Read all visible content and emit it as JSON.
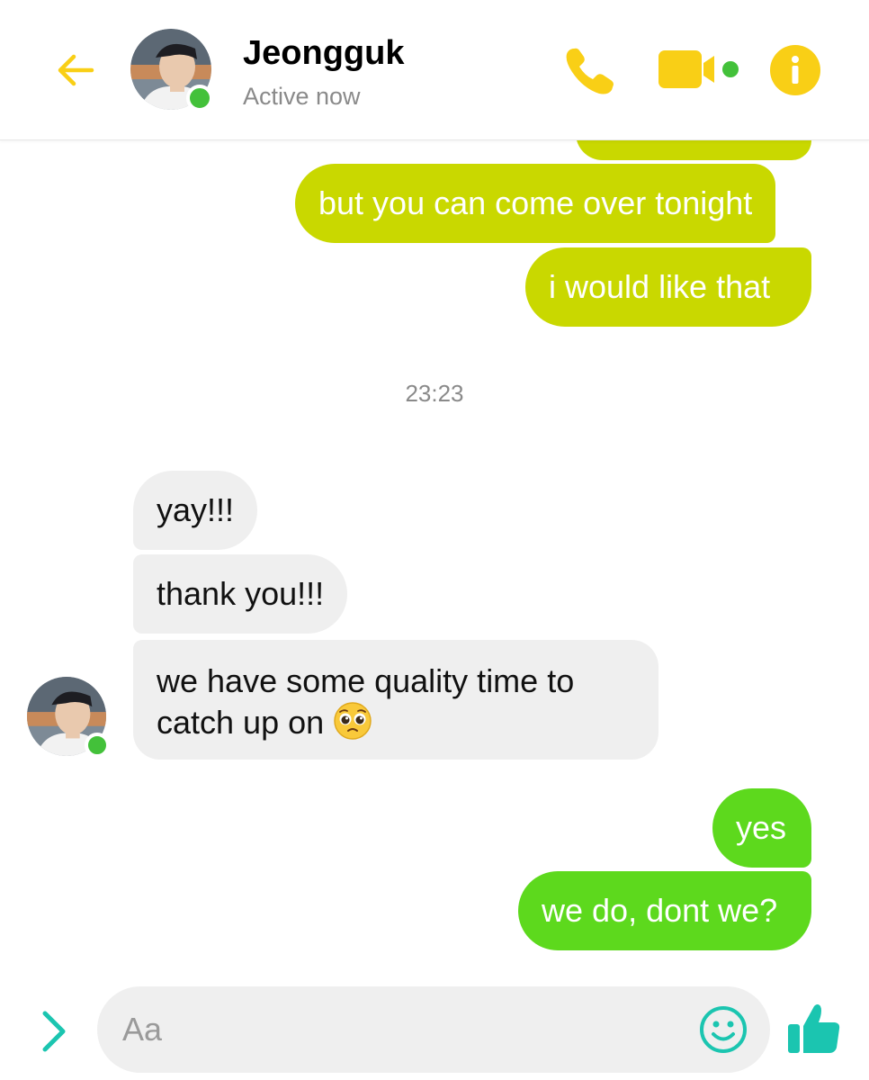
{
  "header": {
    "contact_name": "Jeongguk",
    "status": "Active now"
  },
  "colors": {
    "accent": "#f9cf16",
    "online": "#43c13a",
    "outgoing_lime": "#c9d800",
    "outgoing_green": "#5dd91d",
    "incoming_bg": "#efefef",
    "composer_accent": "#1bc5b0"
  },
  "icons": {
    "back": "back-arrow-icon",
    "call": "phone-icon",
    "video": "video-camera-icon",
    "info": "info-icon",
    "expand": "chevron-right-icon",
    "emoji": "smiley-icon",
    "like": "thumbs-up-icon"
  },
  "messages": {
    "out_1": "but you can come over tonight",
    "out_2": "i would like that",
    "timestamp": "23:23",
    "in_1": "yay!!!",
    "in_2": "thank you!!!",
    "in_3": "we have some quality time to catch up on",
    "in_3_emoji": "pleading-face-emoji",
    "out_3": "yes",
    "out_4": "we do, dont we?"
  },
  "composer": {
    "placeholder": "Aa"
  }
}
